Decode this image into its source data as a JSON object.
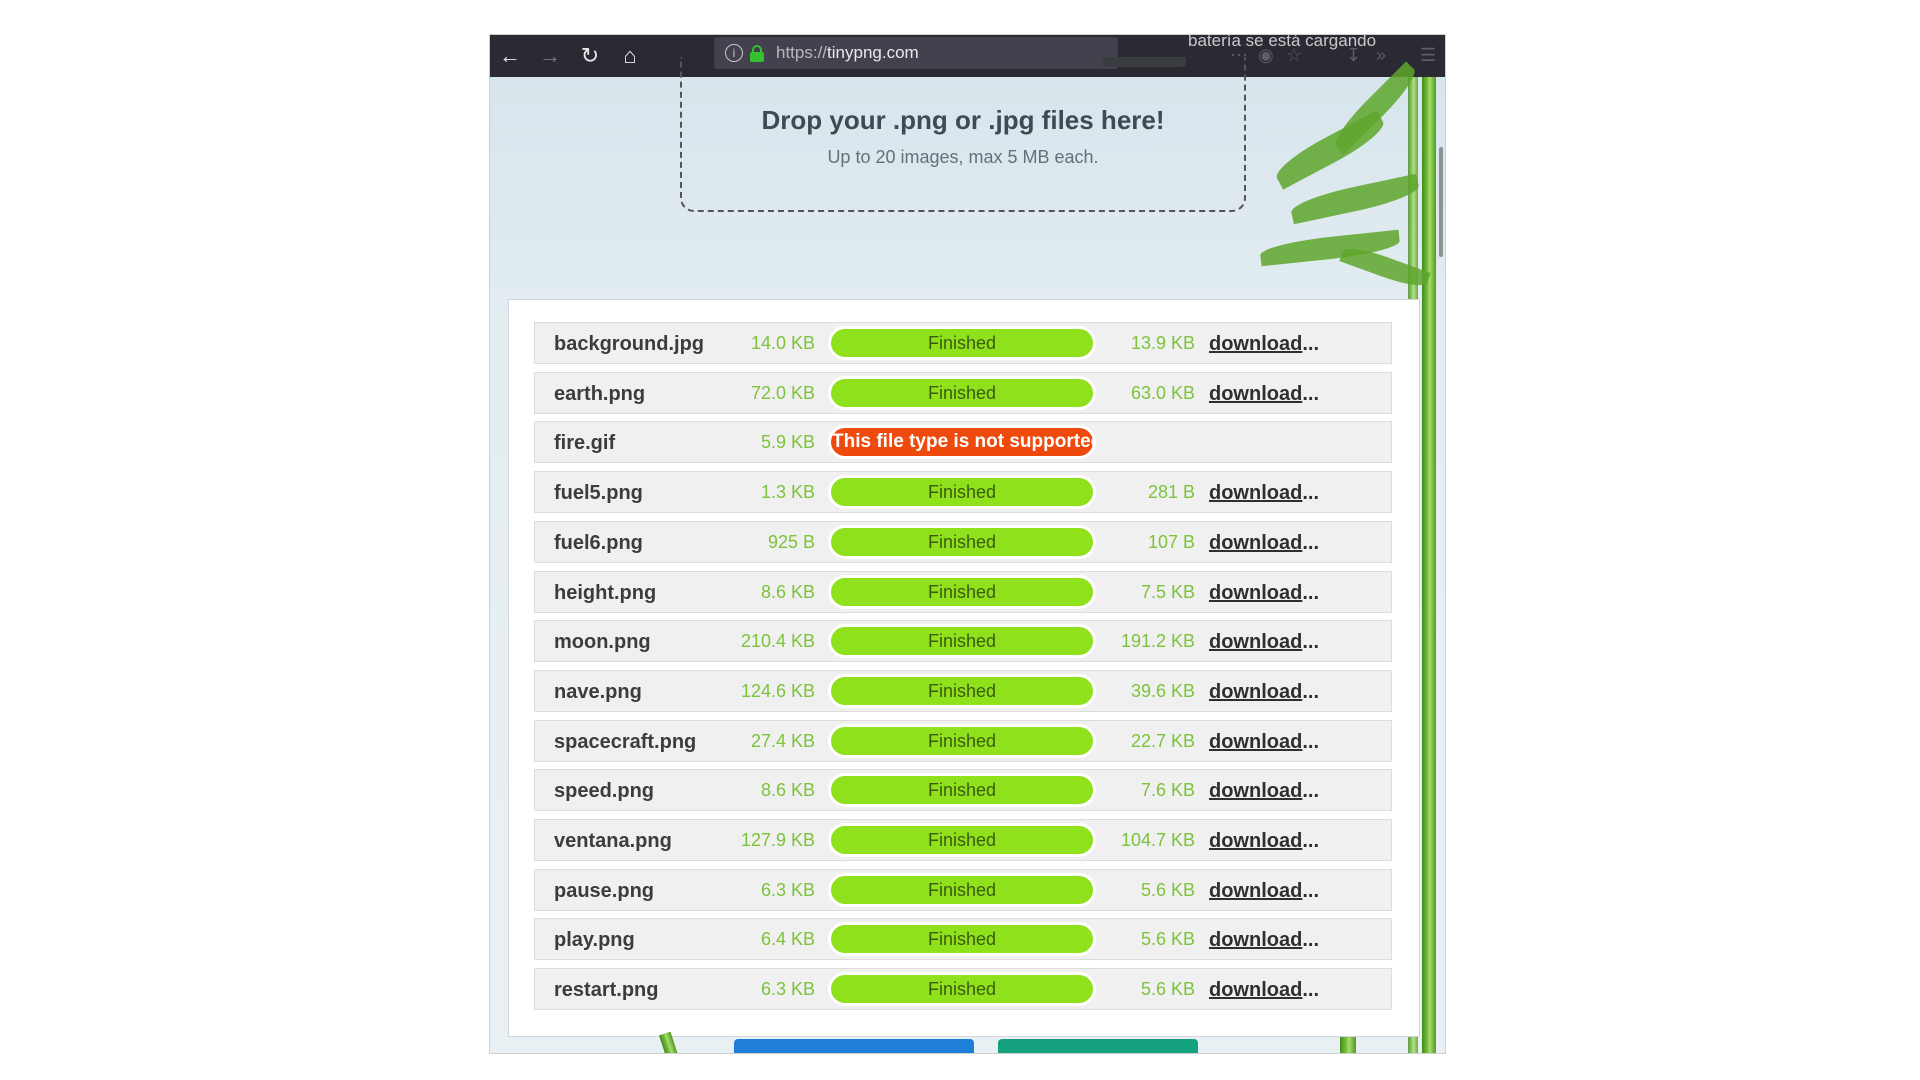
{
  "browser": {
    "url_protocol": "https://",
    "url_host": "tinypng.com",
    "status_message": "batería se está cargando"
  },
  "dropzone": {
    "title": "Drop your .png or .jpg files here!",
    "subtitle": "Up to 20 images, max 5 MB each."
  },
  "colors": {
    "finished_bar": "#8ee11b",
    "error_bar": "#ee4a0d",
    "size_text": "#7cc33a"
  },
  "files": [
    {
      "name": "background.jpg",
      "original": "14.0 KB",
      "status": "Finished",
      "compressed": "13.9 KB",
      "link": "download",
      "error": false
    },
    {
      "name": "earth.png",
      "original": "72.0 KB",
      "status": "Finished",
      "compressed": "63.0 KB",
      "link": "download",
      "error": false
    },
    {
      "name": "fire.gif",
      "original": "5.9 KB",
      "status": "This file type is not supported",
      "compressed": "",
      "link": "",
      "error": true
    },
    {
      "name": "fuel5.png",
      "original": "1.3 KB",
      "status": "Finished",
      "compressed": "281 B",
      "link": "download",
      "error": false
    },
    {
      "name": "fuel6.png",
      "original": "925 B",
      "status": "Finished",
      "compressed": "107 B",
      "link": "download",
      "error": false
    },
    {
      "name": "height.png",
      "original": "8.6 KB",
      "status": "Finished",
      "compressed": "7.5 KB",
      "link": "download",
      "error": false
    },
    {
      "name": "moon.png",
      "original": "210.4 KB",
      "status": "Finished",
      "compressed": "191.2 KB",
      "link": "download",
      "error": false
    },
    {
      "name": "nave.png",
      "original": "124.6 KB",
      "status": "Finished",
      "compressed": "39.6 KB",
      "link": "download",
      "error": false
    },
    {
      "name": "spacecraft.png",
      "original": "27.4 KB",
      "status": "Finished",
      "compressed": "22.7 KB",
      "link": "download",
      "error": false
    },
    {
      "name": "speed.png",
      "original": "8.6 KB",
      "status": "Finished",
      "compressed": "7.6 KB",
      "link": "download",
      "error": false
    },
    {
      "name": "ventana.png",
      "original": "127.9 KB",
      "status": "Finished",
      "compressed": "104.7 KB",
      "link": "download",
      "error": false
    },
    {
      "name": "pause.png",
      "original": "6.3 KB",
      "status": "Finished",
      "compressed": "5.6 KB",
      "link": "download",
      "error": false
    },
    {
      "name": "play.png",
      "original": "6.4 KB",
      "status": "Finished",
      "compressed": "5.6 KB",
      "link": "download",
      "error": false
    },
    {
      "name": "restart.png",
      "original": "6.3 KB",
      "status": "Finished",
      "compressed": "5.6 KB",
      "link": "download",
      "error": false
    }
  ]
}
